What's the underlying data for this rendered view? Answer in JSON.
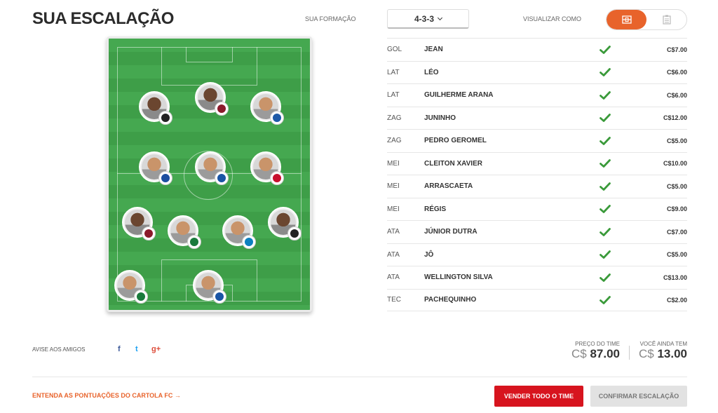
{
  "header": {
    "title": "SUA ESCALAÇÃO",
    "formation_label": "SUA FORMAÇÃO",
    "formation_value": "4-3-3",
    "view_label": "VISUALIZAR COMO",
    "view_options": [
      "field-view-icon",
      "list-view-icon"
    ],
    "active_view": "field-view-icon"
  },
  "lineup": [
    {
      "pos": "GOL",
      "name": "JEAN",
      "status": "check-icon",
      "price": "C$7.00"
    },
    {
      "pos": "LAT",
      "name": "LÉO",
      "status": "check-icon",
      "price": "C$6.00"
    },
    {
      "pos": "LAT",
      "name": "GUILHERME ARANA",
      "status": "check-icon",
      "price": "C$6.00"
    },
    {
      "pos": "ZAG",
      "name": "JUNINHO",
      "status": "check-icon",
      "price": "C$12.00"
    },
    {
      "pos": "ZAG",
      "name": "PEDRO GEROMEL",
      "status": "check-icon",
      "price": "C$5.00"
    },
    {
      "pos": "MEI",
      "name": "CLEITON XAVIER",
      "status": "check-icon",
      "price": "C$10.00"
    },
    {
      "pos": "MEI",
      "name": "ARRASCAETA",
      "status": "check-icon",
      "price": "C$5.00"
    },
    {
      "pos": "MEI",
      "name": "RÉGIS",
      "status": "check-icon",
      "price": "C$9.00"
    },
    {
      "pos": "ATA",
      "name": "JÚNIOR DUTRA",
      "status": "check-icon",
      "price": "C$7.00"
    },
    {
      "pos": "ATA",
      "name": "JÔ",
      "status": "check-icon",
      "price": "C$5.00"
    },
    {
      "pos": "ATA",
      "name": "WELLINGTON SILVA",
      "status": "check-icon",
      "price": "C$13.00"
    },
    {
      "pos": "TEC",
      "name": "PACHEQUINHO",
      "status": "check-icon",
      "price": "C$2.00"
    }
  ],
  "share": {
    "label": "AVISE AOS AMIGOS",
    "facebook": "f",
    "twitter": "t",
    "googleplus": "g+"
  },
  "totals": {
    "team_price_label": "PREÇO DO TIME",
    "team_price_currency": "C$",
    "team_price_value": "87.00",
    "remaining_label": "VOCÊ AINDA TEM",
    "remaining_currency": "C$",
    "remaining_value": "13.00"
  },
  "footer": {
    "help_link": "ENTENDA AS PONTUAÇÕES DO CARTOLA FC →",
    "sell_button": "VENDER TODO O TIME",
    "confirm_button": "CONFIRMAR ESCALAÇÃO"
  },
  "colors": {
    "accent": "#e8632b",
    "sell": "#d7141e",
    "check": "#3a9a3a",
    "field": "#45a850",
    "facebook": "#3b5998",
    "twitter": "#1da1f2",
    "googleplus": "#dd4b39"
  }
}
